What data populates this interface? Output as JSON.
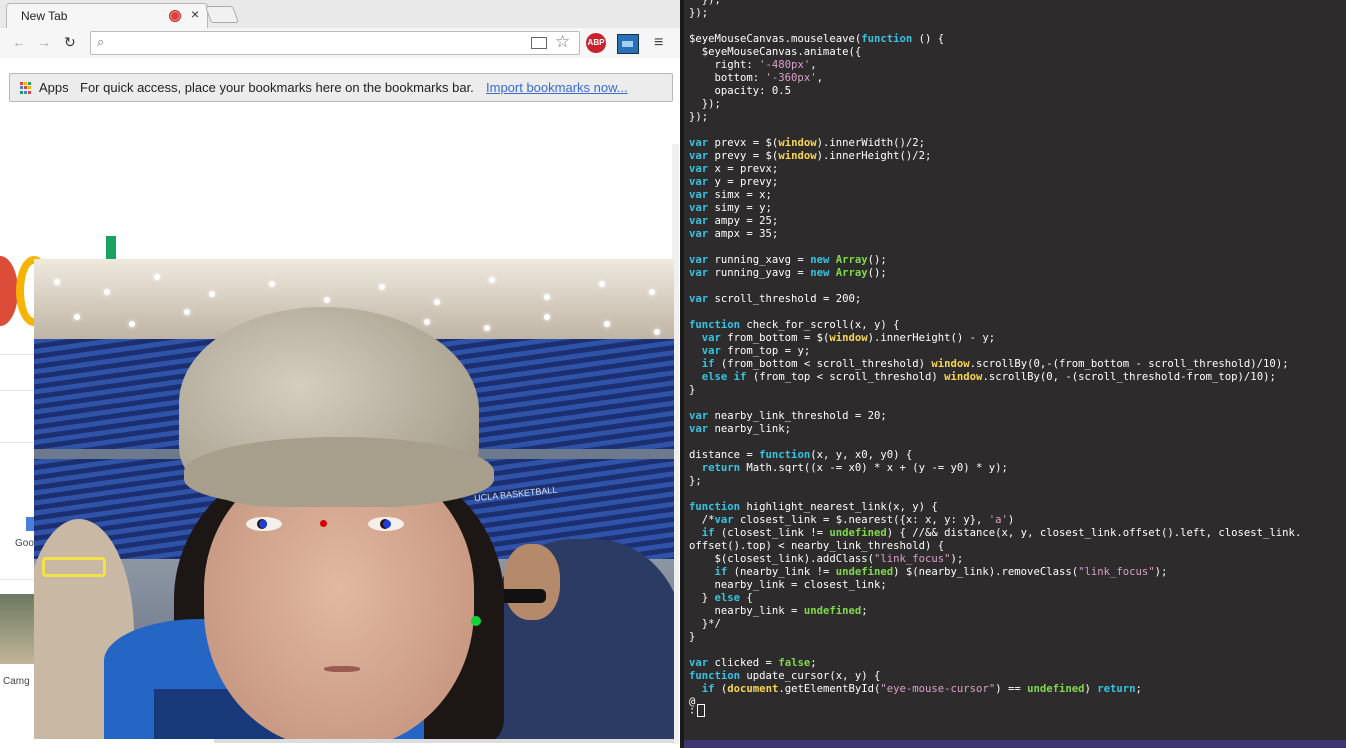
{
  "browser": {
    "tab": {
      "title": "New Tab",
      "close_glyph": "×"
    },
    "toolbar": {
      "back_glyph": "←",
      "forward_glyph": "→",
      "reload_glyph": "↻",
      "search_glyph": "🔍",
      "star_glyph": "☆",
      "menu_glyph": "≡",
      "abp_label": "ABP",
      "omnibox_value": ""
    },
    "bookmarks_bar": {
      "apps_label": "Apps",
      "message": "For quick access, place your bookmarks here on the bookmarks bar.",
      "import_link": "Import bookmarks now..."
    },
    "page": {
      "tile_label_1": "Goo",
      "tile_label_2": "Camg"
    },
    "apps_colors": [
      "#e2413a",
      "#f4b400",
      "#1aa260",
      "#4a7edb",
      "#e2413a",
      "#f4b400",
      "#1aa260",
      "#4a7edb",
      "#e2413a"
    ]
  },
  "webcam": {
    "tracker_colors": {
      "eye": "#1f3dd9",
      "center": "#d40000",
      "gaze": "#12d33a"
    },
    "banner_text": "UCLA BASKETBALL"
  },
  "terminal": {
    "code_lines": [
      "  });",
      "});",
      "",
      "$eyeMouseCanvas.mouseleave(function () {",
      "  $eyeMouseCanvas.animate({",
      "    right: '-480px',",
      "    bottom: '-360px',",
      "    opacity: 0.5",
      "  });",
      "});",
      "",
      "var prevx = $(window).innerWidth()/2;",
      "var prevy = $(window).innerHeight()/2;",
      "var x = prevx;",
      "var y = prevy;",
      "var simx = x;",
      "var simy = y;",
      "var ampy = 25;",
      "var ampx = 35;",
      "",
      "var running_xavg = new Array();",
      "var running_yavg = new Array();",
      "",
      "var scroll_threshold = 200;",
      "",
      "function check_for_scroll(x, y) {",
      "  var from_bottom = $(window).innerHeight() - y;",
      "  var from_top = y;",
      "  if (from_bottom < scroll_threshold) window.scrollBy(0,-(from_bottom - scroll_threshold)/10);",
      "  else if (from_top < scroll_threshold) window.scrollBy(0, -(scroll_threshold-from_top)/10);",
      "}",
      "",
      "var nearby_link_threshold = 20;",
      "var nearby_link;",
      "",
      "distance = function(x, y, x0, y0) {",
      "  return Math.sqrt((x -= x0) * x + (y -= y0) * y);",
      "};",
      "",
      "function highlight_nearest_link(x, y) {",
      "  /*var closest_link = $.nearest({x: x, y: y}, 'a')",
      "  if (closest_link != undefined) { //&& distance(x, y, closest_link.offset().left, closest_link.",
      "offset().top) < nearby_link_threshold) {",
      "    $(closest_link).addClass(\"link_focus\");",
      "    if (nearby_link != undefined) $(nearby_link).removeClass(\"link_focus\");",
      "    nearby_link = closest_link;",
      "  } else {",
      "    nearby_link = undefined;",
      "  }*/",
      "}",
      "",
      "var clicked = false;",
      "function update_cursor(x, y) {",
      "  if (document.getElementById(\"eye-mouse-cursor\") == undefined) return;",
      "@"
    ],
    "prompt": ":"
  }
}
